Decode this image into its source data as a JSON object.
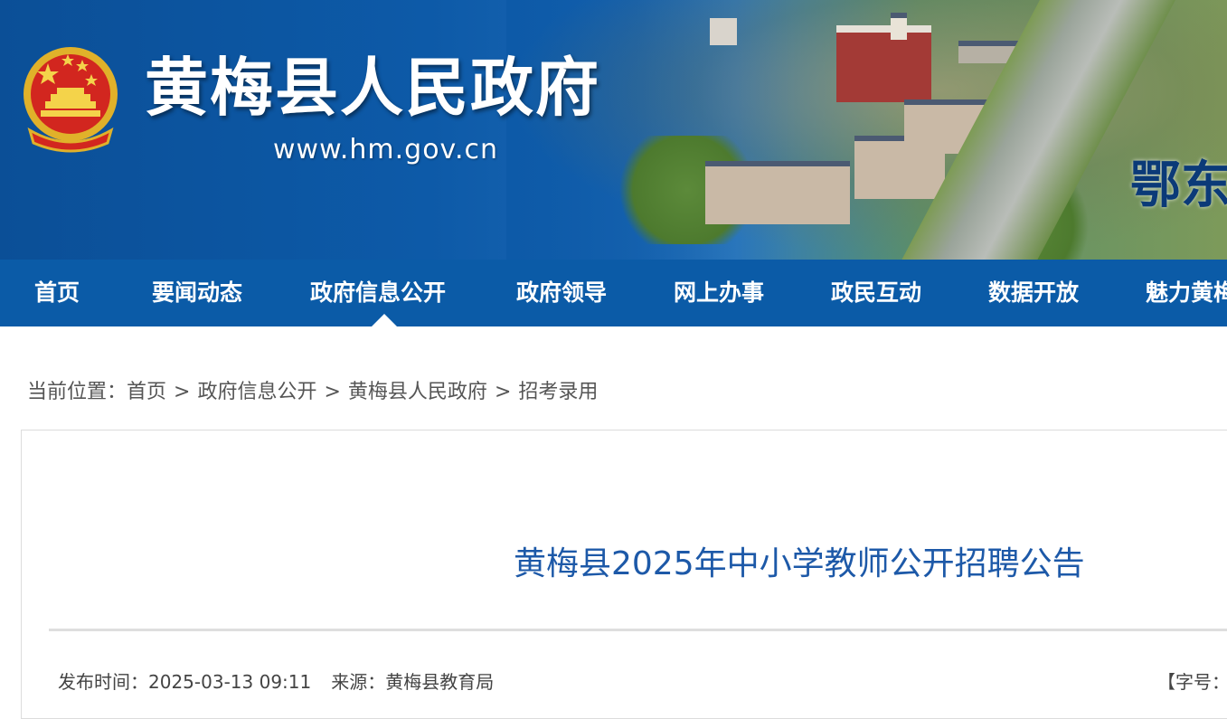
{
  "header": {
    "site_title": "黄梅县人民政府",
    "site_url": "www.hm.gov.cn",
    "banner_text": "鄂东"
  },
  "nav": {
    "items": [
      {
        "label": "首页"
      },
      {
        "label": "要闻动态"
      },
      {
        "label": "政府信息公开"
      },
      {
        "label": "政府领导"
      },
      {
        "label": "网上办事"
      },
      {
        "label": "政民互动"
      },
      {
        "label": "数据开放"
      },
      {
        "label": "魅力黄梅"
      }
    ],
    "active_index": 2
  },
  "breadcrumb": {
    "prefix": "当前位置：",
    "separator": ">",
    "items": [
      "首页",
      "政府信息公开",
      "黄梅县人民政府",
      "招考录用"
    ]
  },
  "article": {
    "title": "黄梅县2025年中小学教师公开招聘公告",
    "publish_label": "发布时间：",
    "publish_time": "2025-03-13 09:11",
    "source_label": "来源：",
    "source": "黄梅县教育局",
    "font_size_label": "【字号："
  },
  "colors": {
    "nav_bg": "#0b5ba7",
    "title_color": "#1d59a8",
    "banner_blue": "#0b4f97"
  },
  "icons": {
    "emblem": "national-emblem-icon"
  }
}
